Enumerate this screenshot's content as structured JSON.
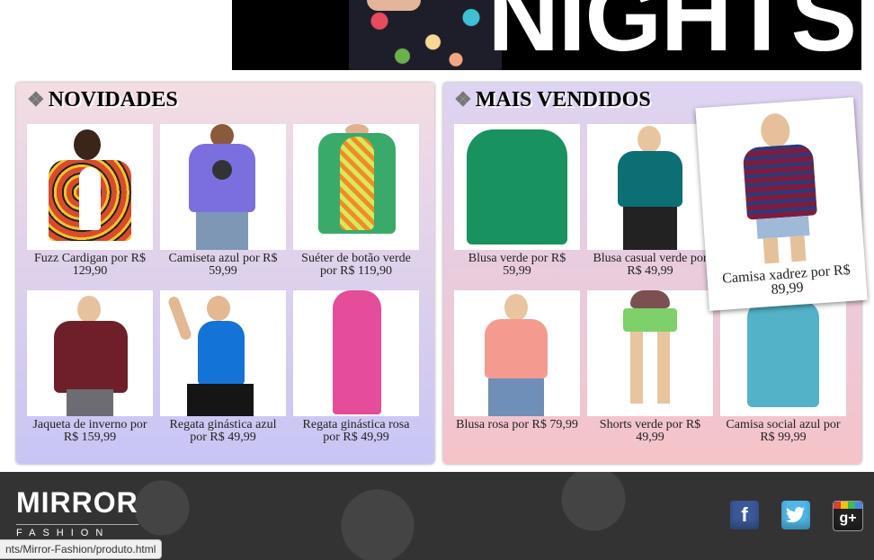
{
  "banner": {
    "text": "NIGHTS"
  },
  "novidades": {
    "title": "NOVIDADES",
    "products": [
      {
        "caption": "Fuzz Cardigan por R$ 129,90"
      },
      {
        "caption": "Camiseta azul por R$ 59,99"
      },
      {
        "caption": "Suéter de botão verde por R$ 119,90"
      },
      {
        "caption": "Jaqueta de inverno por R$ 159,99"
      },
      {
        "caption": "Regata ginástica azul por R$ 49,99"
      },
      {
        "caption": "Regata ginástica rosa por R$ 49,99"
      }
    ]
  },
  "mais_vendidos": {
    "title": "MAIS VENDIDOS",
    "products": [
      {
        "caption": "Blusa verde por R$ 59,99"
      },
      {
        "caption": "Blusa casual verde por R$ 49,99"
      },
      {
        "caption": "Blusa rosa por R$ 79,99"
      },
      {
        "caption": "Shorts verde por R$ 49,99"
      },
      {
        "caption": "Camisa social azul por R$ 99,99"
      }
    ],
    "featured": {
      "caption": "Camisa xadrez por R$ 89,99"
    }
  },
  "footer": {
    "logo_main": "MIRROR",
    "logo_sub": "FASHION",
    "social": {
      "facebook": "f",
      "google": "g+"
    }
  },
  "status_url": "nts/Mirror-Fashion/produto.html",
  "colors": {
    "panel_left_top": "#f4dde2",
    "panel_left_bottom": "#c8c5f5",
    "panel_right_top": "#ddd4f2",
    "panel_right_bottom": "#f5c3c9",
    "footer_bg": "#333333"
  }
}
